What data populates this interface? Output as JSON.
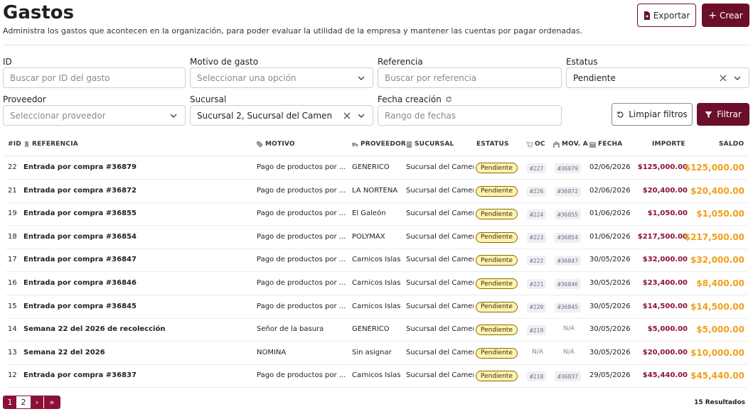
{
  "header": {
    "title": "Gastos",
    "subtitle": "Administra los gastos que acontecen en la organización, para poder evaluar la utilidad de la empresa y mantener las cuentas por pagar ordenadas.",
    "export_label": "Exportar",
    "create_label": "Crear"
  },
  "filters": {
    "id": {
      "label": "ID",
      "placeholder": "Buscar por ID del gasto"
    },
    "motivo": {
      "label": "Motivo de gasto",
      "placeholder": "Seleccionar una opción"
    },
    "referencia": {
      "label": "Referencia",
      "placeholder": "Buscar por referencia"
    },
    "estatus": {
      "label": "Estatus",
      "value": "Pendiente"
    },
    "proveedor": {
      "label": "Proveedor",
      "placeholder": "Seleccionar proveedor"
    },
    "sucursal": {
      "label": "Sucursal",
      "value": "Sucursal 2, Sucursal del Camen"
    },
    "fecha": {
      "label": "Fecha creación",
      "placeholder": "Rango de fechas"
    },
    "clear_label": "Limpiar filtros",
    "filter_label": "Filtrar"
  },
  "table": {
    "columns": {
      "id": "#ID",
      "referencia": "REFERENCIA",
      "motivo": "MOTIVO",
      "proveedor": "PROVEEDOR",
      "sucursal": "SUCURSAL",
      "estatus": "ESTATUS",
      "oc": "OC",
      "mov": "MOV. A",
      "fecha": "FECHA",
      "importe": "IMPORTE",
      "saldo": "SALDO"
    },
    "rows": [
      {
        "id": "22",
        "ref": "Entrada por compra #36879",
        "motivo": "Pago de productos por ...",
        "proveedor": "GENERICO",
        "sucursal": "Sucursal del Camen",
        "estatus": "Pendiente",
        "oc": "#227",
        "mov": "#36879",
        "fecha": "02/06/2026",
        "importe": "$125,000.00",
        "saldo": "$125,000.00"
      },
      {
        "id": "21",
        "ref": "Entrada por compra #36872",
        "motivo": "Pago de productos por ...",
        "proveedor": "LA NORTEÑA",
        "sucursal": "Sucursal del Camen",
        "estatus": "Pendiente",
        "oc": "#226",
        "mov": "#36872",
        "fecha": "02/06/2026",
        "importe": "$20,400.00",
        "saldo": "$20,400.00"
      },
      {
        "id": "19",
        "ref": "Entrada por compra #36855",
        "motivo": "Pago de productos por ...",
        "proveedor": "El Galeón",
        "sucursal": "Sucursal del Camen",
        "estatus": "Pendiente",
        "oc": "#224",
        "mov": "#36855",
        "fecha": "01/06/2026",
        "importe": "$1,050.00",
        "saldo": "$1,050.00"
      },
      {
        "id": "18",
        "ref": "Entrada por compra #36854",
        "motivo": "Pago de productos por ...",
        "proveedor": "POLYMAX",
        "sucursal": "Sucursal del Camen",
        "estatus": "Pendiente",
        "oc": "#223",
        "mov": "#36854",
        "fecha": "01/06/2026",
        "importe": "$217,500.00",
        "saldo": "$217,500.00"
      },
      {
        "id": "17",
        "ref": "Entrada por compra #36847",
        "motivo": "Pago de productos por ...",
        "proveedor": "Carnicos Islas",
        "sucursal": "Sucursal del Camen",
        "estatus": "Pendiente",
        "oc": "#222",
        "mov": "#36847",
        "fecha": "30/05/2026",
        "importe": "$32,000.00",
        "saldo": "$32,000.00"
      },
      {
        "id": "16",
        "ref": "Entrada por compra #36846",
        "motivo": "Pago de productos por ...",
        "proveedor": "Carnicos Islas",
        "sucursal": "Sucursal del Camen",
        "estatus": "Pendiente",
        "oc": "#221",
        "mov": "#36846",
        "fecha": "30/05/2026",
        "importe": "$23,400.00",
        "saldo": "$8,400.00"
      },
      {
        "id": "15",
        "ref": "Entrada por compra #36845",
        "motivo": "Pago de productos por ...",
        "proveedor": "Carnicos Islas",
        "sucursal": "Sucursal del Camen",
        "estatus": "Pendiente",
        "oc": "#220",
        "mov": "#36845",
        "fecha": "30/05/2026",
        "importe": "$14,500.00",
        "saldo": "$14,500.00"
      },
      {
        "id": "14",
        "ref": "Semana 22 del 2026 de recolección",
        "motivo": "Señor de la basura",
        "proveedor": "GENERICO",
        "sucursal": "Sucursal del Camen",
        "estatus": "Pendiente",
        "oc": "#219",
        "mov": "N/A",
        "fecha": "30/05/2026",
        "importe": "$5,000.00",
        "saldo": "$5,000.00"
      },
      {
        "id": "13",
        "ref": "Semana 22 del 2026",
        "motivo": "NÓMINA",
        "proveedor": "Sin asignar",
        "sucursal": "Sucursal del Camen",
        "estatus": "Pendiente",
        "oc": "N/A",
        "mov": "N/A",
        "fecha": "30/05/2026",
        "importe": "$20,000.00",
        "saldo": "$10,000.00"
      },
      {
        "id": "12",
        "ref": "Entrada por compra #36837",
        "motivo": "Pago de productos por ...",
        "proveedor": "Carnicos Islas",
        "sucursal": "Sucursal del Camen",
        "estatus": "Pendiente",
        "oc": "#218",
        "mov": "#36837",
        "fecha": "29/05/2026",
        "importe": "$45,440.00",
        "saldo": "$45,440.00"
      }
    ]
  },
  "pagination": {
    "pages": [
      "1",
      "2"
    ],
    "current": "2",
    "next": "›",
    "last": "»",
    "results": "15 Resultados"
  },
  "colors": {
    "brand": "#6b0f2a",
    "importe": "#8a1236",
    "saldo": "#f0a01a",
    "badge_bg": "#fff3b0"
  }
}
